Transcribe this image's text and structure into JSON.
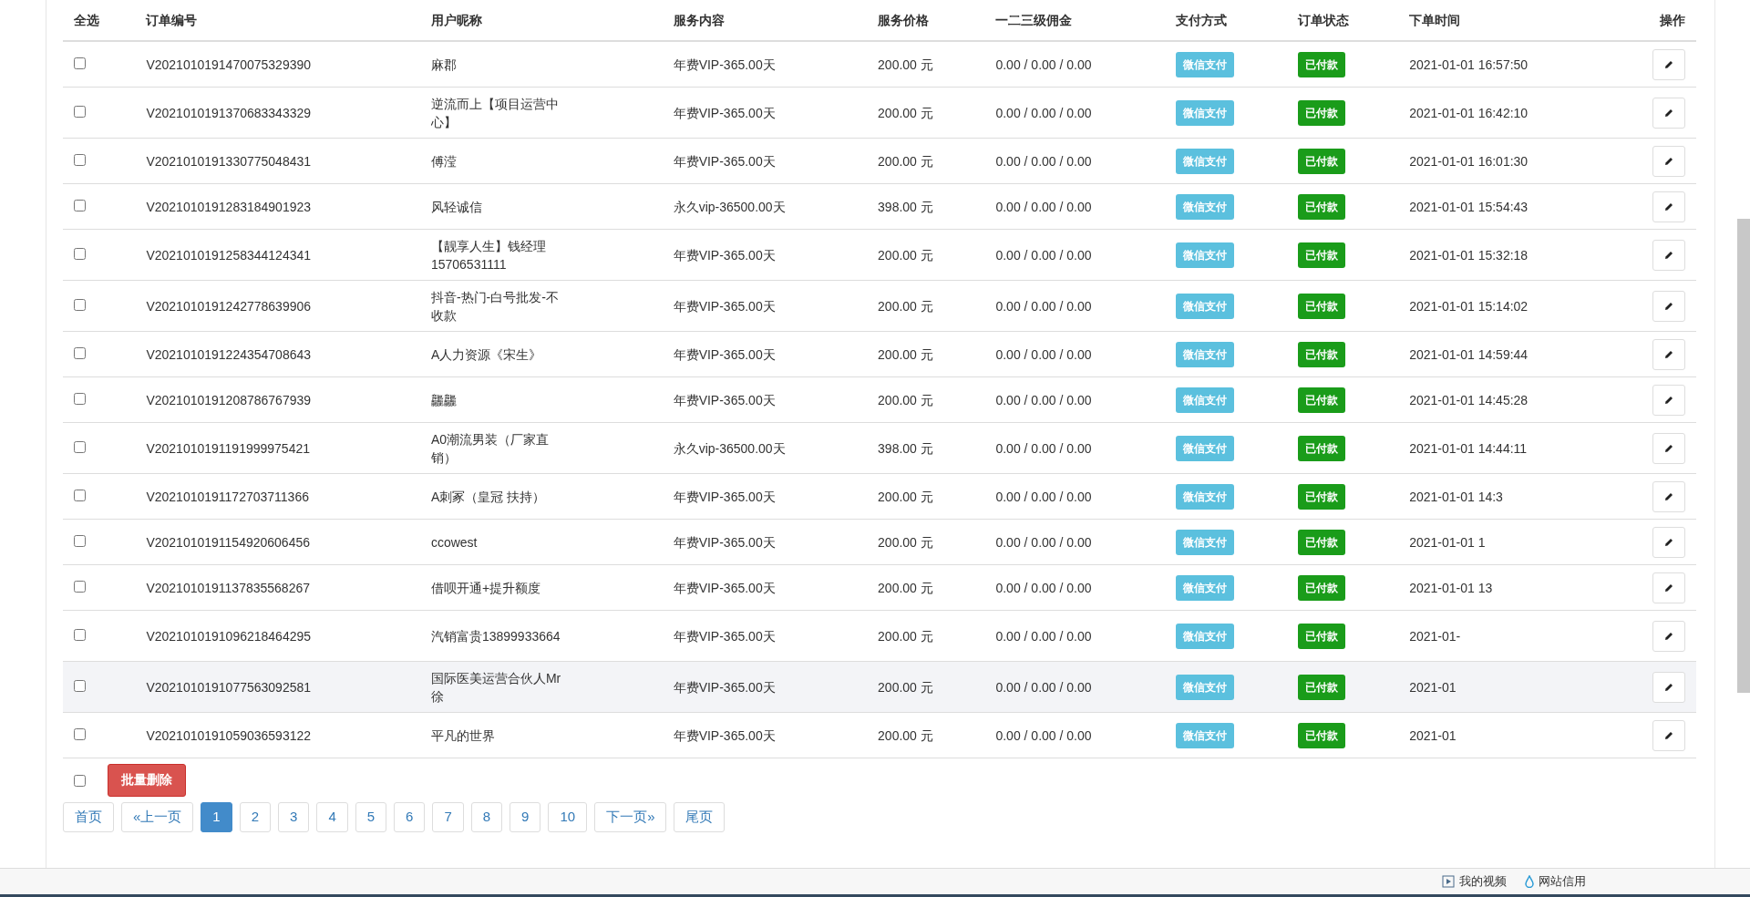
{
  "table": {
    "columns": [
      "全选",
      "订单编号",
      "用户昵称",
      "服务内容",
      "服务价格",
      "一二三级佣金",
      "支付方式",
      "订单状态",
      "下单时间",
      "操作"
    ],
    "rows": [
      {
        "checked": false,
        "highlighted": false,
        "order_no": "V2021010191470075329390",
        "nickname": "麻郡",
        "service": "年费VIP-365.00天",
        "price": "200.00 元",
        "commission": "0.00 / 0.00 / 0.00",
        "payment": "微信支付",
        "status": "已付款",
        "time": "2021-01-01 16:57:50"
      },
      {
        "checked": false,
        "highlighted": false,
        "order_no": "V2021010191370683343329",
        "nickname": "逆流而上【项目运营中心】",
        "service": "年费VIP-365.00天",
        "price": "200.00 元",
        "commission": "0.00 / 0.00 / 0.00",
        "payment": "微信支付",
        "status": "已付款",
        "time": "2021-01-01 16:42:10"
      },
      {
        "checked": false,
        "highlighted": false,
        "order_no": "V2021010191330775048431",
        "nickname": "傅滢",
        "service": "年费VIP-365.00天",
        "price": "200.00 元",
        "commission": "0.00 / 0.00 / 0.00",
        "payment": "微信支付",
        "status": "已付款",
        "time": "2021-01-01 16:01:30"
      },
      {
        "checked": false,
        "highlighted": false,
        "order_no": "V2021010191283184901923",
        "nickname": "风轻诚信",
        "service": "永久vip-36500.00天",
        "price": "398.00 元",
        "commission": "0.00 / 0.00 / 0.00",
        "payment": "微信支付",
        "status": "已付款",
        "time": "2021-01-01 15:54:43"
      },
      {
        "checked": false,
        "highlighted": false,
        "order_no": "V2021010191258344124341",
        "nickname": "【靓享人生】钱经理15706531111",
        "service": "年费VIP-365.00天",
        "price": "200.00 元",
        "commission": "0.00 / 0.00 / 0.00",
        "payment": "微信支付",
        "status": "已付款",
        "time": "2021-01-01 15:32:18"
      },
      {
        "checked": false,
        "highlighted": false,
        "order_no": "V2021010191242778639906",
        "nickname": "抖音-热门-白号批发-不收款",
        "service": "年费VIP-365.00天",
        "price": "200.00 元",
        "commission": "0.00 / 0.00 / 0.00",
        "payment": "微信支付",
        "status": "已付款",
        "time": "2021-01-01 15:14:02"
      },
      {
        "checked": false,
        "highlighted": false,
        "order_no": "V2021010191224354708643",
        "nickname": "A人力资源《宋生》",
        "service": "年费VIP-365.00天",
        "price": "200.00 元",
        "commission": "0.00 / 0.00 / 0.00",
        "payment": "微信支付",
        "status": "已付款",
        "time": "2021-01-01 14:59:44"
      },
      {
        "checked": false,
        "highlighted": false,
        "order_no": "V2021010191208786767939",
        "nickname": "龘龘",
        "service": "年费VIP-365.00天",
        "price": "200.00 元",
        "commission": "0.00 / 0.00 / 0.00",
        "payment": "微信支付",
        "status": "已付款",
        "time": "2021-01-01 14:45:28"
      },
      {
        "checked": false,
        "highlighted": false,
        "order_no": "V2021010191191999975421",
        "nickname": "A0潮流男装（厂家直销）",
        "service": "永久vip-36500.00天",
        "price": "398.00 元",
        "commission": "0.00 / 0.00 / 0.00",
        "payment": "微信支付",
        "status": "已付款",
        "time": "2021-01-01 14:44:11"
      },
      {
        "checked": false,
        "highlighted": false,
        "order_no": "V2021010191172703711366",
        "nickname": "A刺冢（皇冠 扶持）",
        "service": "年费VIP-365.00天",
        "price": "200.00 元",
        "commission": "0.00 / 0.00 / 0.00",
        "payment": "微信支付",
        "status": "已付款",
        "time": "2021-01-01 14:3"
      },
      {
        "checked": false,
        "highlighted": false,
        "order_no": "V2021010191154920606456",
        "nickname": "ccowest",
        "service": "年费VIP-365.00天",
        "price": "200.00 元",
        "commission": "0.00 / 0.00 / 0.00",
        "payment": "微信支付",
        "status": "已付款",
        "time": "2021-01-01 1"
      },
      {
        "checked": false,
        "highlighted": false,
        "order_no": "V2021010191137835568267",
        "nickname": "借呗开通+提升额度",
        "service": "年费VIP-365.00天",
        "price": "200.00 元",
        "commission": "0.00 / 0.00 / 0.00",
        "payment": "微信支付",
        "status": "已付款",
        "time": "2021-01-01 13"
      },
      {
        "checked": false,
        "highlighted": false,
        "order_no": "V2021010191096218464295",
        "nickname": "汽销富贵13899933664",
        "service": "年费VIP-365.00天",
        "price": "200.00 元",
        "commission": "0.00 / 0.00 / 0.00",
        "payment": "微信支付",
        "status": "已付款",
        "time": "2021-01-"
      },
      {
        "checked": false,
        "highlighted": true,
        "order_no": "V2021010191077563092581",
        "nickname": "国际医美运营合伙人Mr徐",
        "service": "年费VIP-365.00天",
        "price": "200.00 元",
        "commission": "0.00 / 0.00 / 0.00",
        "payment": "微信支付",
        "status": "已付款",
        "time": "2021-01"
      },
      {
        "checked": false,
        "highlighted": false,
        "order_no": "V2021010191059036593122",
        "nickname": "平凡的世界",
        "service": "年费VIP-365.00天",
        "price": "200.00 元",
        "commission": "0.00 / 0.00 / 0.00",
        "payment": "微信支付",
        "status": "已付款",
        "time": "2021-01"
      }
    ]
  },
  "bulk": {
    "checked": false,
    "delete_button": "批量删除"
  },
  "pagination": [
    {
      "label": "首页",
      "selected": false
    },
    {
      "label": "«上一页",
      "selected": false
    },
    {
      "label": "1",
      "selected": true
    },
    {
      "label": "2",
      "selected": false
    },
    {
      "label": "3",
      "selected": false
    },
    {
      "label": "4",
      "selected": false
    },
    {
      "label": "5",
      "selected": false
    },
    {
      "label": "6",
      "selected": false
    },
    {
      "label": "7",
      "selected": false
    },
    {
      "label": "8",
      "selected": false
    },
    {
      "label": "9",
      "selected": false
    },
    {
      "label": "10",
      "selected": false
    },
    {
      "label": "下一页»",
      "selected": false
    },
    {
      "label": "尾页",
      "selected": false
    }
  ],
  "status_bar": {
    "items": [
      {
        "kind": "video",
        "label": "我的视频"
      },
      {
        "kind": "credit",
        "label": "网站信用"
      }
    ]
  }
}
